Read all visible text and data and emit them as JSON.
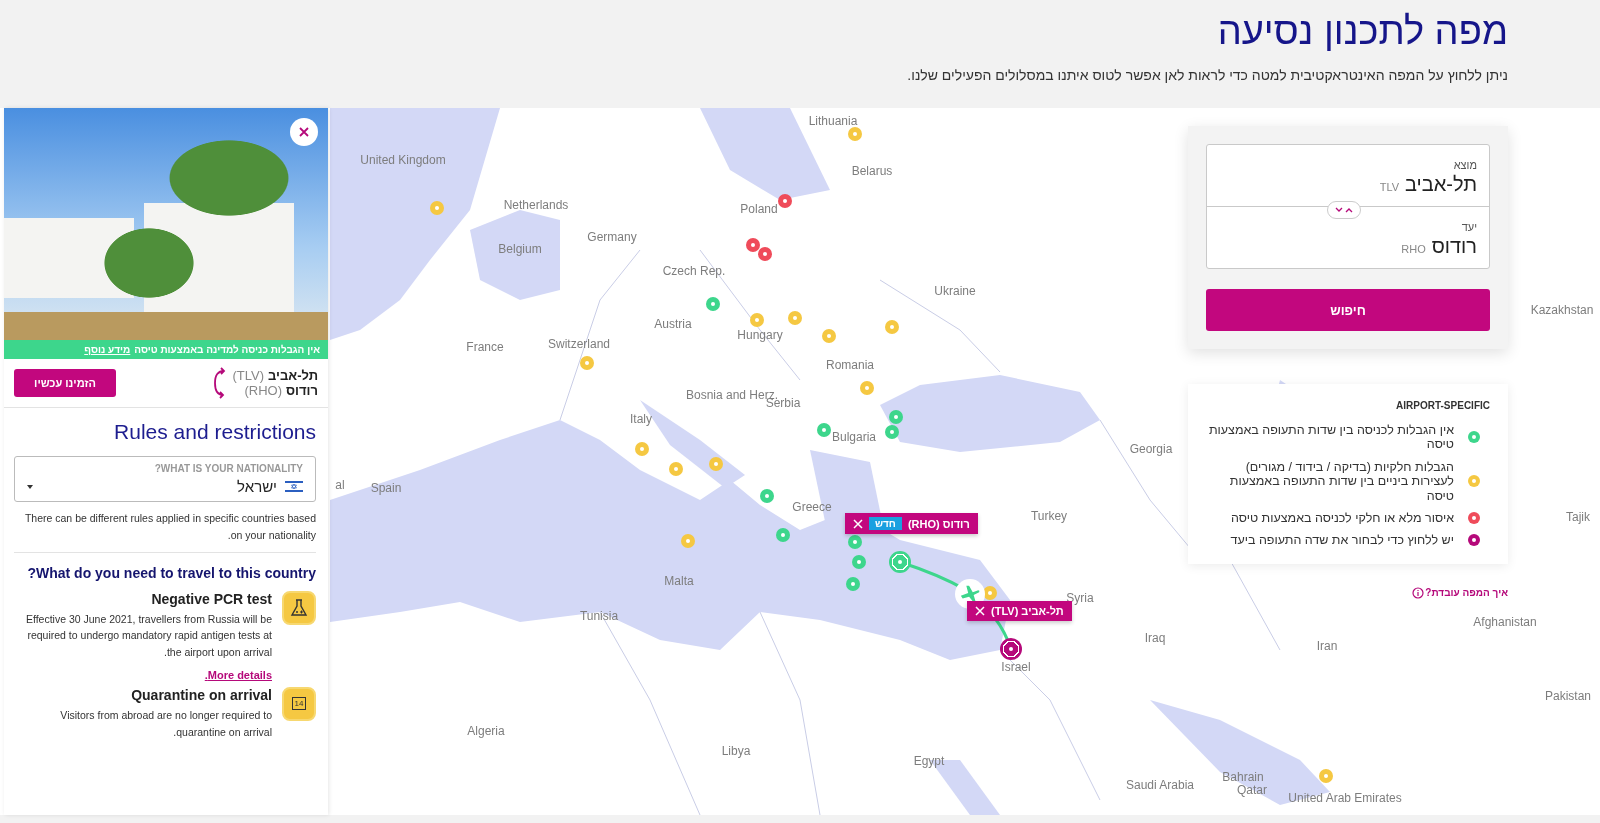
{
  "header": {
    "title": "מפה לתכנון נסיעה",
    "subtitle": "ניתן ללחוץ על המפה האינטראקטיבית למטה כדי לראות לאן אפשר לטוס איתנו במסלולים הפעילים שלנו."
  },
  "destination_panel": {
    "banner": {
      "text": "אין הגבלות כניסה למדינה באמצעות טיסה",
      "link": "מידע נוסף"
    },
    "route": {
      "origin": "תל-אביב",
      "origin_code": "(TLV)",
      "destination": "רודוס",
      "destination_code": "(RHO)"
    },
    "book_button": "הזמינו עכשיו",
    "rules_title": "Rules and restrictions",
    "nationality": {
      "label": "WHAT IS YOUR NATIONALITY?",
      "value": "ישראל"
    },
    "nationality_note": "There can be different rules applied in specific countries based on your nationality.",
    "question": "What do you need to travel to this country?",
    "requirements": [
      {
        "kind": "test",
        "title": "Negative PCR test",
        "text": "Effective 30 June 2021, travellers from Russia will be required to undergo mandatory rapid antigen tests at the airport upon arrival.",
        "link": "More details."
      },
      {
        "kind": "quarantine",
        "title": "Quarantine on arrival",
        "icon_text": "14",
        "text": "Visitors from abroad are no longer required to quarantine on arrival."
      }
    ]
  },
  "search_card": {
    "origin_label": "מוצא",
    "origin": "תל-אביב",
    "origin_code": "TLV",
    "destination_label": "יעד",
    "destination": "רודוס",
    "destination_code": "RHO",
    "search_button": "חיפוש"
  },
  "legend": {
    "title": "AIRPORT-SPECIFIC",
    "items": [
      {
        "label": "אין הגבלות לכניסה בין שדות התעופה באמצעות טיסה",
        "color": "#3dd68c"
      },
      {
        "label": "הגבלות חלקיות (בדיקה / בידוד / מגורים) לעצירות ביניים בין שדות התעופה באמצעות טיסה",
        "color": "#f5c842"
      },
      {
        "label": "איסור מלא או חלקי לכניסה באמצעות טיסה",
        "color": "#ef4b5a"
      },
      {
        "label": "יש ללחוץ כדי לבחור את שדה התעופה ביעד",
        "color": "#b5097a"
      }
    ]
  },
  "help_link": "איך המפה עובדת?",
  "map": {
    "countries": [
      "Lithuania",
      "United Kingdom",
      "Belarus",
      "Netherlands",
      "Poland",
      "Germany",
      "Belgium",
      "Czech Rep.",
      "Ukraine",
      "Kazakhstan",
      "Austria",
      "France",
      "Switzerland",
      "Hungary",
      "Romania",
      "Italy",
      "Bosnia and Herz.",
      "Serbia",
      "Bulgaria",
      "Georgia",
      "Spain",
      "Greece",
      "Turkey",
      "Malta",
      "Syria",
      "Tunisia",
      "Afghanistan",
      "Iraq",
      "Iran",
      "Israel",
      "Tajik",
      "Pakistan",
      "Algeria",
      "Libya",
      "Egypt",
      "Saudi Arabia",
      "Bahrain",
      "Qatar",
      "United Arab Emirates",
      "al"
    ],
    "popups": [
      {
        "label": "רודוס (RHO)",
        "badge": "חדש"
      },
      {
        "label": "תל-אביב (TLV)"
      }
    ],
    "airports": [
      {
        "color": "#f5c842",
        "selected": false
      },
      {
        "color": "#f5c842",
        "selected": false
      },
      {
        "color": "#f5c842",
        "selected": false
      },
      {
        "color": "#f5c842",
        "selected": false
      },
      {
        "color": "#f5c842",
        "selected": false
      },
      {
        "color": "#f5c842",
        "selected": false
      },
      {
        "color": "#f5c842",
        "selected": false
      },
      {
        "color": "#f5c842",
        "selected": false
      },
      {
        "color": "#f5c842",
        "selected": false
      },
      {
        "color": "#f5c842",
        "selected": false
      },
      {
        "color": "#f5c842",
        "selected": false
      },
      {
        "color": "#f5c842",
        "selected": false
      },
      {
        "color": "#f5c842",
        "selected": false
      },
      {
        "color": "#f5c842",
        "selected": false
      },
      {
        "color": "#3dd68c",
        "selected": false
      },
      {
        "color": "#3dd68c",
        "selected": false
      },
      {
        "color": "#3dd68c",
        "selected": false
      },
      {
        "color": "#3dd68c",
        "selected": false
      },
      {
        "color": "#3dd68c",
        "selected": false
      },
      {
        "color": "#3dd68c",
        "selected": false
      },
      {
        "color": "#3dd68c",
        "selected": false
      },
      {
        "color": "#3dd68c",
        "selected": false
      },
      {
        "color": "#3dd68c",
        "selected": false
      },
      {
        "color": "#3dd68c",
        "selected": true
      },
      {
        "color": "#ef4b5a",
        "selected": false
      },
      {
        "color": "#ef4b5a",
        "selected": false
      },
      {
        "color": "#ef4b5a",
        "selected": false
      },
      {
        "color": "#b5097a",
        "selected": true
      }
    ]
  }
}
